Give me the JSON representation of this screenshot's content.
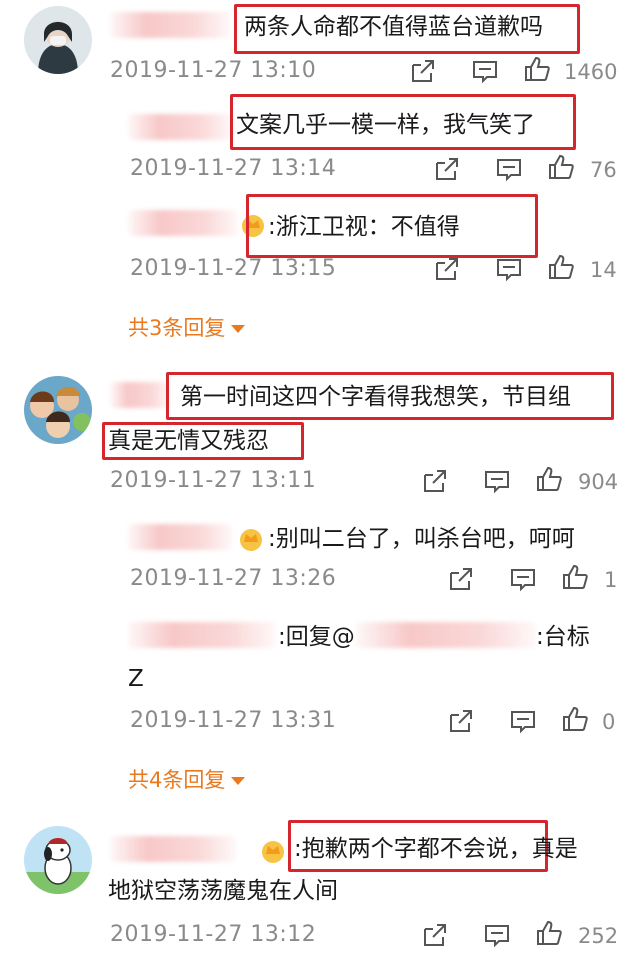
{
  "comments": [
    {
      "text": "两条人命都不值得蓝台道歉吗",
      "time": "2019-11-27 13:10",
      "likes": "1460",
      "replies": [
        {
          "text": "文案几乎一模一样，我气笑了",
          "time": "2019-11-27 13:14",
          "likes": "76"
        },
        {
          "text": ":浙江卫视：不值得",
          "time": "2019-11-27 13:15",
          "likes": "14"
        }
      ],
      "more": "共3条回复"
    },
    {
      "text_line1": "第一时间这四个字看得我想笑，节目组",
      "text_line2": "真是无情又残忍",
      "time": "2019-11-27 13:11",
      "likes": "904",
      "replies": [
        {
          "text": ":别叫二台了，叫杀台吧，呵呵",
          "time": "2019-11-27 13:26",
          "likes": "1"
        },
        {
          "text_a": ":回复@",
          "text_b": ":台标",
          "text_c": "Z",
          "time": "2019-11-27 13:31",
          "likes": "0"
        }
      ],
      "more": "共4条回复"
    },
    {
      "text_line1": ":抱歉两个字都不会说，真是",
      "text_line2": "地狱空荡荡魔鬼在人间",
      "time": "2019-11-27 13:12",
      "likes": "252"
    }
  ],
  "icons": {
    "share": "share-icon",
    "comment": "comment-icon",
    "like": "like-icon"
  },
  "colors": {
    "highlight_box": "#d4262c",
    "more_link": "#e8791e",
    "timestamp": "#8a8a8a"
  }
}
